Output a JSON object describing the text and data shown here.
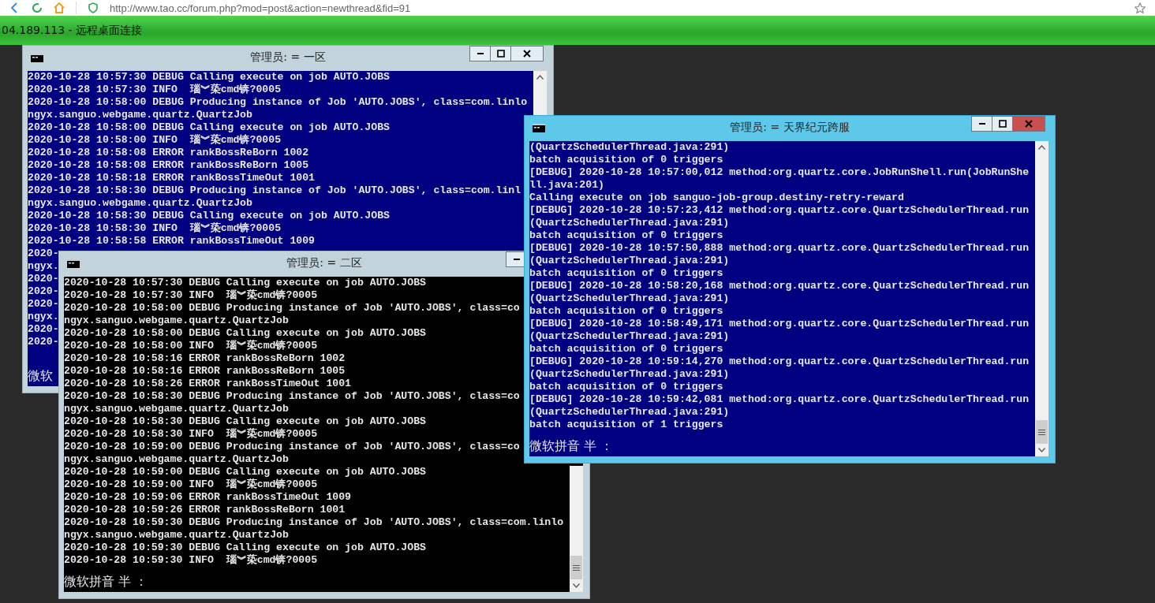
{
  "browser": {
    "url": "http://www.tao.cc/forum.php?mod=post&action=newthread&fid=91"
  },
  "remote_desktop": {
    "title": "04.189.113 - 远程桌面连接"
  },
  "windows": [
    {
      "title": "管理员: = 一区",
      "active": false,
      "kind": "blue",
      "controls": [
        {
          "kind": "minimize"
        },
        {
          "kind": "maximize"
        },
        {
          "kind": "close"
        }
      ],
      "lines": [
        "2020-10-28 10:57:30 DEBUG Calling execute on job AUTO.JOBS",
        "2020-10-28 10:57:30 INFO  瑙︾蒅cmd锛?0005",
        "2020-10-28 10:58:00 DEBUG Producing instance of Job 'AUTO.JOBS', class=com.linlo",
        "ngyx.sanguo.webgame.quartz.QuartzJob",
        "2020-10-28 10:58:00 DEBUG Calling execute on job AUTO.JOBS",
        "2020-10-28 10:58:00 INFO  瑙︾蒅cmd锛?0005",
        "2020-10-28 10:58:08 ERROR rankBossReBorn 1002",
        "2020-10-28 10:58:08 ERROR rankBossReBorn 1005",
        "2020-10-28 10:58:18 ERROR rankBossTimeOut 1001",
        "2020-10-28 10:58:30 DEBUG Producing instance of Job 'AUTO.JOBS', class=com.linl",
        "ngyx.sanguo.webgame.quartz.QuartzJob",
        "2020-10-28 10:58:30 DEBUG Calling execute on job AUTO.JOBS",
        "2020-10-28 10:58:30 INFO  瑙︾蒅cmd锛?0005",
        "2020-10-28 10:58:58 ERROR rankBossTimeOut 1009",
        "2020-",
        "ngyx.",
        "2020-",
        "2020-",
        "2020-",
        "ngyx.",
        "2020-",
        "2020-"
      ],
      "ime": "微软"
    },
    {
      "title": "管理员: = 二区",
      "active": false,
      "kind": "black",
      "controls": [
        {
          "kind": "minimize"
        }
      ],
      "lines": [
        "2020-10-28 10:57:30 DEBUG Calling execute on job AUTO.JOBS",
        "2020-10-28 10:57:30 INFO  瑙︾蒅cmd锛?0005",
        "2020-10-28 10:58:00 DEBUG Producing instance of Job 'AUTO.JOBS', class=co",
        "ngyx.sanguo.webgame.quartz.QuartzJob",
        "2020-10-28 10:58:00 DEBUG Calling execute on job AUTO.JOBS",
        "2020-10-28 10:58:00 INFO  瑙︾蒅cmd锛?0005",
        "2020-10-28 10:58:16 ERROR rankBossReBorn 1002",
        "2020-10-28 10:58:16 ERROR rankBossReBorn 1005",
        "2020-10-28 10:58:26 ERROR rankBossTimeOut 1001",
        "2020-10-28 10:58:30 DEBUG Producing instance of Job 'AUTO.JOBS', class=co",
        "ngyx.sanguo.webgame.quartz.QuartzJob",
        "2020-10-28 10:58:30 DEBUG Calling execute on job AUTO.JOBS",
        "2020-10-28 10:58:30 INFO  瑙︾蒅cmd锛?0005",
        "2020-10-28 10:59:00 DEBUG Producing instance of Job 'AUTO.JOBS', class=co",
        "ngyx.sanguo.webgame.quartz.QuartzJob",
        "2020-10-28 10:59:00 DEBUG Calling execute on job AUTO.JOBS",
        "2020-10-28 10:59:00 INFO  瑙︾蒅cmd锛?0005",
        "2020-10-28 10:59:06 ERROR rankBossTimeOut 1009",
        "2020-10-28 10:59:26 ERROR rankBossReBorn 1001",
        "2020-10-28 10:59:30 DEBUG Producing instance of Job 'AUTO.JOBS', class=com.linlo",
        "ngyx.sanguo.webgame.quartz.QuartzJob",
        "2020-10-28 10:59:30 DEBUG Calling execute on job AUTO.JOBS",
        "2020-10-28 10:59:30 INFO  瑙︾蒅cmd锛?0005"
      ],
      "ime": "微软拼音 半 ："
    },
    {
      "title": "管理员: = 天界纪元跨服",
      "active": true,
      "kind": "blue",
      "controls": [
        {
          "kind": "minimize"
        },
        {
          "kind": "maximize"
        },
        {
          "kind": "close"
        }
      ],
      "lines": [
        "(QuartzSchedulerThread.java:291)",
        "batch acquisition of 0 triggers",
        "[DEBUG] 2020-10-28 10:57:00,012 method:org.quartz.core.JobRunShell.run(JobRunShe",
        "ll.java:201)",
        "Calling execute on job sanguo-job-group.destiny-retry-reward",
        "[DEBUG] 2020-10-28 10:57:23,412 method:org.quartz.core.QuartzSchedulerThread.run",
        "(QuartzSchedulerThread.java:291)",
        "batch acquisition of 0 triggers",
        "[DEBUG] 2020-10-28 10:57:50,888 method:org.quartz.core.QuartzSchedulerThread.run",
        "(QuartzSchedulerThread.java:291)",
        "batch acquisition of 0 triggers",
        "[DEBUG] 2020-10-28 10:58:20,168 method:org.quartz.core.QuartzSchedulerThread.run",
        "(QuartzSchedulerThread.java:291)",
        "batch acquisition of 0 triggers",
        "[DEBUG] 2020-10-28 10:58:49,171 method:org.quartz.core.QuartzSchedulerThread.run",
        "(QuartzSchedulerThread.java:291)",
        "batch acquisition of 0 triggers",
        "[DEBUG] 2020-10-28 10:59:14,270 method:org.quartz.core.QuartzSchedulerThread.run",
        "(QuartzSchedulerThread.java:291)",
        "batch acquisition of 0 triggers",
        "[DEBUG] 2020-10-28 10:59:42,081 method:org.quartz.core.QuartzSchedulerThread.run",
        "(QuartzSchedulerThread.java:291)",
        "batch acquisition of 1 triggers"
      ],
      "ime": "微软拼音 半 ："
    }
  ]
}
